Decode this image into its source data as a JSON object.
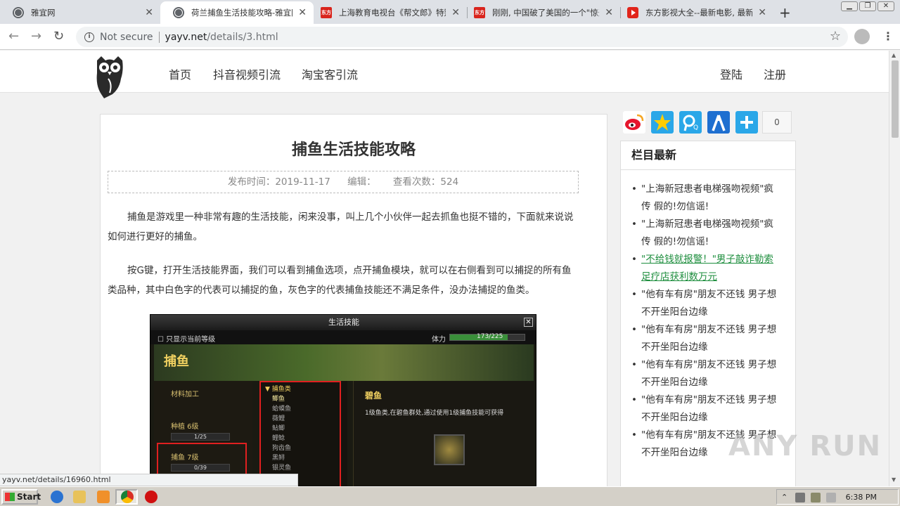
{
  "browser": {
    "tabs": [
      {
        "title": "雅宜网",
        "favicon": "globe-icon"
      },
      {
        "title": "荷兰捕鱼生活技能攻略-雅宜网",
        "favicon": "globe-icon"
      },
      {
        "title": "上海教育电视台《帮文郎》特别报",
        "favicon": "eastday-icon"
      },
      {
        "title": "刚刚, 中国破了美国的一个\"惊天",
        "favicon": "eastday-icon"
      },
      {
        "title": "东方影视大全--最新电影, 最新",
        "favicon": "video-play-icon"
      }
    ],
    "favicon_label": "东方",
    "security": "Not secure",
    "url_host": "yayv.net",
    "url_path": "/details/3.html",
    "status_url": "yayv.net/details/16960.html"
  },
  "site": {
    "nav": [
      "首页",
      "抖音视频引流",
      "淘宝客引流"
    ],
    "login": "登陆",
    "register": "注册"
  },
  "article": {
    "title": "捕鱼生活技能攻略",
    "meta_date": "发布时间：2019-11-17",
    "meta_editor": "编辑：",
    "meta_views": "查看次数：524",
    "para1": "捕鱼是游戏里一种非常有趣的生活技能，闲来没事，叫上几个小伙伴一起去抓鱼也挺不错的，下面就来说说如何进行更好的捕鱼。",
    "para2": "按G键，打开生活技能界面，我们可以看到捕鱼选项，点开捕鱼模块，就可以在右侧看到可以捕捉的所有鱼类品种，其中白色字的代表可以捕捉的鱼，灰色字的代表捕鱼技能还不满足条件，没办法捕捉的鱼类。"
  },
  "game_screenshot": {
    "window_title": "生活技能",
    "close": "✕",
    "only_current": "只显示当前等级",
    "stamina_label": "体力",
    "stamina_value": "173/225",
    "stamina_fraction": 0.77,
    "banner": "捕鱼",
    "left_rows": [
      "材料加工",
      "种植  6级",
      "1/25",
      "捕鱼  7级",
      "0/39"
    ],
    "list_category": "▼ 捕鱼类",
    "list_items": [
      "鲫鱼",
      "蛤蟆鱼",
      "薇鲤",
      "鲇鲫",
      "鲤鲶",
      "狗齿鱼",
      "黑鲟",
      "银灵鱼"
    ],
    "detail_name": "碧鱼",
    "detail_desc": "1级鱼类,在碧鱼群处,通过使用1级捕鱼技能可获得"
  },
  "share": {
    "count": "0",
    "icons": [
      "weibo-icon",
      "qzone-icon",
      "tencent-weibo-icon",
      "renren-icon",
      "more-plus-icon"
    ]
  },
  "sidebar": {
    "heading": "栏目最新",
    "items": [
      "\"上海新冠患者电梯强吻视频\"疯传 假的!勿信谣!",
      "\"上海新冠患者电梯强吻视频\"疯传 假的!勿信谣!",
      "\"不给钱就报警！\"男子敲诈勒索足疗店获利数万元",
      "\"他有车有房\"朋友不还钱 男子想不开坐阳台边缘",
      "\"他有车有房\"朋友不还钱 男子想不开坐阳台边缘",
      "\"他有车有房\"朋友不还钱 男子想不开坐阳台边缘",
      "\"他有车有房\"朋友不还钱 男子想不开坐阳台边缘",
      "\"他有车有房\"朋友不还钱 男子想不开坐阳台边缘"
    ],
    "hovered_index": 2
  },
  "watermark": "ANY RUN",
  "taskbar": {
    "start": "Start",
    "clock": "6:38 PM"
  }
}
